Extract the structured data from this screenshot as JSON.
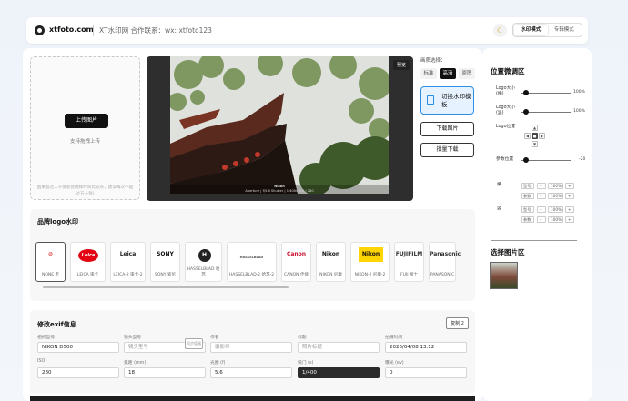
{
  "header": {
    "site_name": "xtfoto.com",
    "subtitle": "XT水印网 合作联系：wx: xtfoto123",
    "moon_icon": "☾",
    "modes": [
      {
        "label": "水印模式",
        "active": true
      },
      {
        "label": "专辑模式",
        "active": false
      }
    ]
  },
  "upload": {
    "button": "上传图片",
    "hint": "支持拖拽上传",
    "note": "国果超过二十张影会模样时间比较长，建议每次不超过五十张)"
  },
  "preview": {
    "tag": "预览",
    "caption_brand": "Nikon",
    "caption_params": "Aperture | f/5.6   Shutter | 1/400s   ISO | 280"
  },
  "frame": {
    "label": "画质选择：",
    "options": [
      {
        "label": "标准",
        "active": false
      },
      {
        "label": "高清",
        "active": true
      },
      {
        "label": "原图",
        "active": false
      }
    ],
    "switch_label": "切换水印模板",
    "download_label": "下载图片",
    "batch_label": "批量下载"
  },
  "brands": {
    "title": "品牌logo水印",
    "items": [
      {
        "logo": "⊘",
        "name": "NONE 无",
        "color": "#d33",
        "selected": true
      },
      {
        "logo": "Leica",
        "name": "LEICA 徕卡",
        "color": "#e20612",
        "selected": false
      },
      {
        "logo": "Leica",
        "name": "LEICA-2 徕卡-2",
        "color": "#222222",
        "selected": false
      },
      {
        "logo": "SONY",
        "name": "SONY 索尼",
        "color": "#111111",
        "selected": false
      },
      {
        "logo": "H",
        "name": "HASSELBLAD 哈苏",
        "color": "#222222",
        "selected": false
      },
      {
        "logo": "HASSELBLAD",
        "name": "HASSELBLAD-2 哈苏-2",
        "color": "#555555",
        "selected": false
      },
      {
        "logo": "Canon",
        "name": "CANON 佳能",
        "color": "#c8102e",
        "selected": false
      },
      {
        "logo": "Nikon",
        "name": "NIKON 尼康",
        "color": "#111111",
        "selected": false
      },
      {
        "logo": "Nikon",
        "name": "NIKON-2 尼康-2",
        "color": "#111111",
        "selected": false
      },
      {
        "logo": "FUJIFILM",
        "name": "FUJI 富士",
        "color": "#333333",
        "selected": false
      },
      {
        "logo": "Panasonic",
        "name": "PANASONIC",
        "color": "#333333",
        "selected": false
      }
    ]
  },
  "exif": {
    "title": "修改exif信息",
    "copy_label": "复制 2",
    "sync_label": "同步值器",
    "fields": [
      {
        "label": "相机型号",
        "value": "NIKON D500",
        "placeholder": false,
        "dark": false
      },
      {
        "label": "镜头型号",
        "value": "镜头型号",
        "placeholder": true,
        "dark": false
      },
      {
        "label": "作者",
        "value": "摄影师",
        "placeholder": true,
        "dark": false
      },
      {
        "label": "标题",
        "value": "照片标题",
        "placeholder": true,
        "dark": false
      },
      {
        "label": "拍摄时间",
        "value": "2026/04/08 13:12",
        "placeholder": false,
        "dark": false
      },
      {
        "label": "ISO",
        "value": "280",
        "placeholder": false,
        "dark": false
      },
      {
        "label": "焦距 (mm)",
        "value": "18",
        "placeholder": false,
        "dark": false
      },
      {
        "label": "光圈 (f)",
        "value": "5.6",
        "placeholder": false,
        "dark": false
      },
      {
        "label": "快门 (s)",
        "value": "1/400",
        "placeholder": false,
        "dark": true
      },
      {
        "label": "曝光 (ev)",
        "value": "0",
        "placeholder": false,
        "dark": false
      }
    ]
  },
  "position_panel": {
    "title": "位置微调区",
    "logo_size_label": "Logo大小(横)",
    "logo_size_value": "100%",
    "logo_size_level": 0.1,
    "logo_size2_label": "Logo大小(竖)",
    "logo_size2_value": "100%",
    "logo_size2_level": 0.1,
    "logo_pos_label": "Logo位置",
    "param_pos_label": "参数位置",
    "param_pos_value": "-20",
    "param_pos_level": 0.1,
    "horizontal_label": "横",
    "vertical_label": "竖",
    "mini_rows": [
      {
        "a": "型号",
        "b": "100%"
      },
      {
        "a": "参数",
        "b": "100%"
      }
    ]
  },
  "select_panel": {
    "title": "选择图片区"
  }
}
